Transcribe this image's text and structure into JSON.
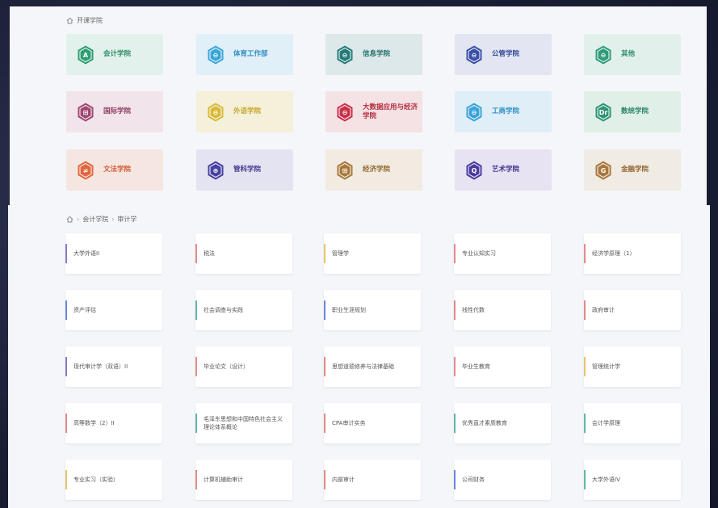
{
  "top": {
    "breadcrumb": "开课学院",
    "colleges": [
      {
        "label": "会计学院",
        "bg": "#e3f1ec",
        "color": "#2e9e72",
        "text": "#2a8f66",
        "glyph": "A"
      },
      {
        "label": "体育工作部",
        "bg": "#e1eff8",
        "color": "#3aa6d8",
        "text": "#2f8fc4",
        "glyph": "⊖"
      },
      {
        "label": "信息学院",
        "bg": "#dde8ea",
        "color": "#237a78",
        "text": "#256f6d",
        "glyph": "⊖"
      },
      {
        "label": "公管学院",
        "bg": "#e3e6f2",
        "color": "#3a4fa6",
        "text": "#33489a",
        "glyph": "⊖"
      },
      {
        "label": "其他",
        "bg": "#e2f0ec",
        "color": "#2f9b7a",
        "text": "#2b8d70",
        "glyph": "⊖"
      },
      {
        "label": "国际学院",
        "bg": "#f1e4ea",
        "color": "#a04670",
        "text": "#8e3d63",
        "glyph": "⊞"
      },
      {
        "label": "外语学院",
        "bg": "#f4f0d9",
        "color": "#d8b93a",
        "text": "#c7a72a",
        "glyph": "⊖"
      },
      {
        "label": "大数据应用与经济学院",
        "bg": "#f4e2e4",
        "color": "#c8324a",
        "text": "#b52c42",
        "glyph": "⊖"
      },
      {
        "label": "工商学院",
        "bg": "#e0eef8",
        "color": "#3ba3d9",
        "text": "#318fc4",
        "glyph": "⊖"
      },
      {
        "label": "数统学院",
        "bg": "#e1efe9",
        "color": "#2f9474",
        "text": "#2a8669",
        "glyph": "Dr"
      },
      {
        "label": "文法学院",
        "bg": "#f6e6e1",
        "color": "#e0673f",
        "text": "#cf5a33",
        "glyph": "≠"
      },
      {
        "label": "管科学院",
        "bg": "#e4e3f1",
        "color": "#4840a0",
        "text": "#3f3890",
        "glyph": "⊕"
      },
      {
        "label": "经济学院",
        "bg": "#f1ebe2",
        "color": "#a7783a",
        "text": "#936830",
        "glyph": "⊞"
      },
      {
        "label": "艺术学院",
        "bg": "#e7e3f2",
        "color": "#4a3aa0",
        "text": "#403390",
        "glyph": "Q"
      },
      {
        "label": "金融学院",
        "bg": "#f0ebe3",
        "color": "#a8763e",
        "text": "#946633",
        "glyph": "G"
      }
    ]
  },
  "bottom": {
    "breadcrumb": [
      "会计学院",
      "审计学"
    ],
    "courses": [
      {
        "label": "大学外语II",
        "bar": "#8a79c9"
      },
      {
        "label": "税法",
        "bar": "#e08a8a"
      },
      {
        "label": "管理学",
        "bar": "#e7c46a"
      },
      {
        "label": "专业认知实习",
        "bar": "#e48a8a"
      },
      {
        "label": "经济学原理（1）",
        "bar": "#e48a8a"
      },
      {
        "label": "资产评估",
        "bar": "#6a86d6"
      },
      {
        "label": "社会调查与实践",
        "bar": "#5fb8a4"
      },
      {
        "label": "职业生涯规划",
        "bar": "#6a86d6"
      },
      {
        "label": "线性代数",
        "bar": "#e08a8a"
      },
      {
        "label": "政府审计",
        "bar": "#e08a8a"
      },
      {
        "label": "现代审计学（双语）II",
        "bar": "#8a79c9"
      },
      {
        "label": "毕业论文（设计）",
        "bar": "#e08a8a"
      },
      {
        "label": "思想道德修养与法律基础",
        "bar": "#e08a8a"
      },
      {
        "label": "毕业生教育",
        "bar": "#e48a8a"
      },
      {
        "label": "管理统计学",
        "bar": "#e7c46a"
      },
      {
        "label": "高等数学（2）II",
        "bar": "#e08a8a"
      },
      {
        "label": "毛泽东思想和中国特色社会主义理论体系概论",
        "bar": "#5fb8a4"
      },
      {
        "label": "CPA审计实务",
        "bar": "#e08a8a"
      },
      {
        "label": "优秀直才素质教育",
        "bar": "#5fb8a4"
      },
      {
        "label": "会计学原理",
        "bar": "#5fb8a4"
      },
      {
        "label": "专业实习（实验）",
        "bar": "#e7c46a"
      },
      {
        "label": "计算机辅助审计",
        "bar": "#e08a8a"
      },
      {
        "label": "内部审计",
        "bar": "#e08a8a"
      },
      {
        "label": "公司财务",
        "bar": "#6a86d6"
      },
      {
        "label": "大学外语IV",
        "bar": "#5fb8a4"
      }
    ]
  }
}
